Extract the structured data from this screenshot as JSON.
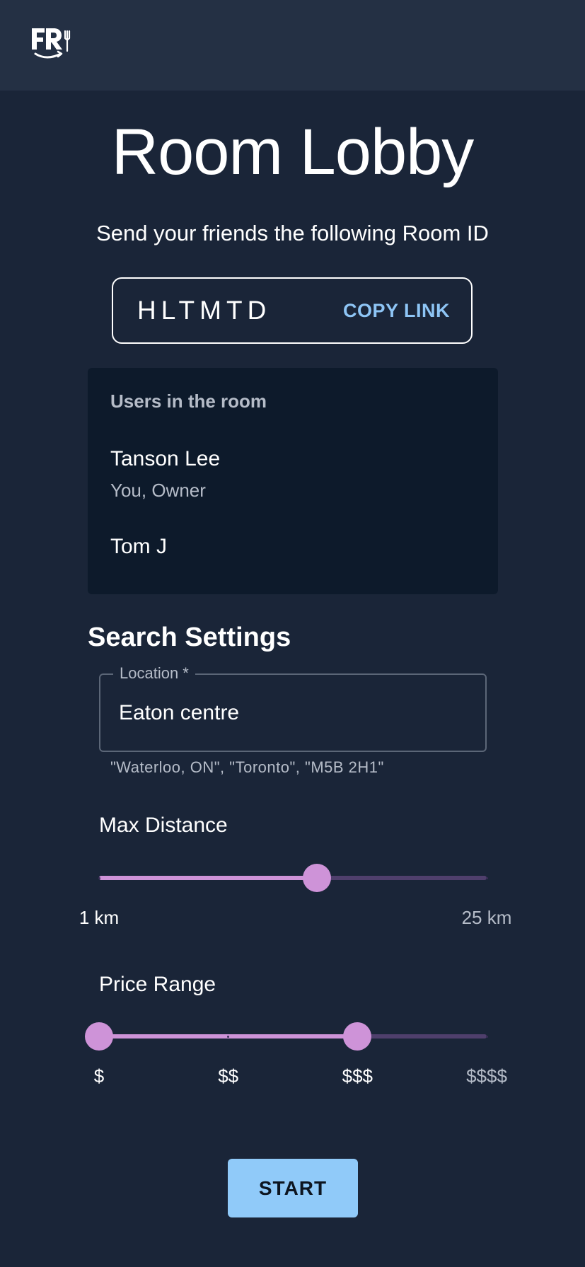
{
  "header": {
    "logo_icon": "fork-restaurant-logo-icon"
  },
  "lobby": {
    "title": "Room Lobby",
    "subtitle": "Send your friends the following Room ID",
    "room_id": "HLTMTD",
    "copy_link_label": "COPY LINK"
  },
  "users": {
    "heading": "Users in the room",
    "list": [
      {
        "name": "Tanson Lee",
        "role": "You, Owner"
      },
      {
        "name": "Tom J",
        "role": ""
      }
    ]
  },
  "search_settings": {
    "title": "Search Settings",
    "location": {
      "label": "Location *",
      "value": "Eaton centre",
      "helper": "\"Waterloo, ON\", \"Toronto\", \"M5B 2H1\""
    },
    "max_distance": {
      "label": "Max Distance",
      "min_label": "1 km",
      "max_label": "25 km",
      "min": 1,
      "max": 25,
      "value": 14.5
    },
    "price_range": {
      "label": "Price Range",
      "marks": [
        "$",
        "$$",
        "$$$",
        "$$$$"
      ],
      "selected_range": [
        1,
        3
      ]
    }
  },
  "actions": {
    "start_label": "START"
  },
  "colors": {
    "background": "#1a2538",
    "topbar": "#243044",
    "card": "#0d1a2b",
    "accent_slider": "#ce93d8",
    "accent_button": "#90caf9",
    "link": "#8ec5f5"
  }
}
